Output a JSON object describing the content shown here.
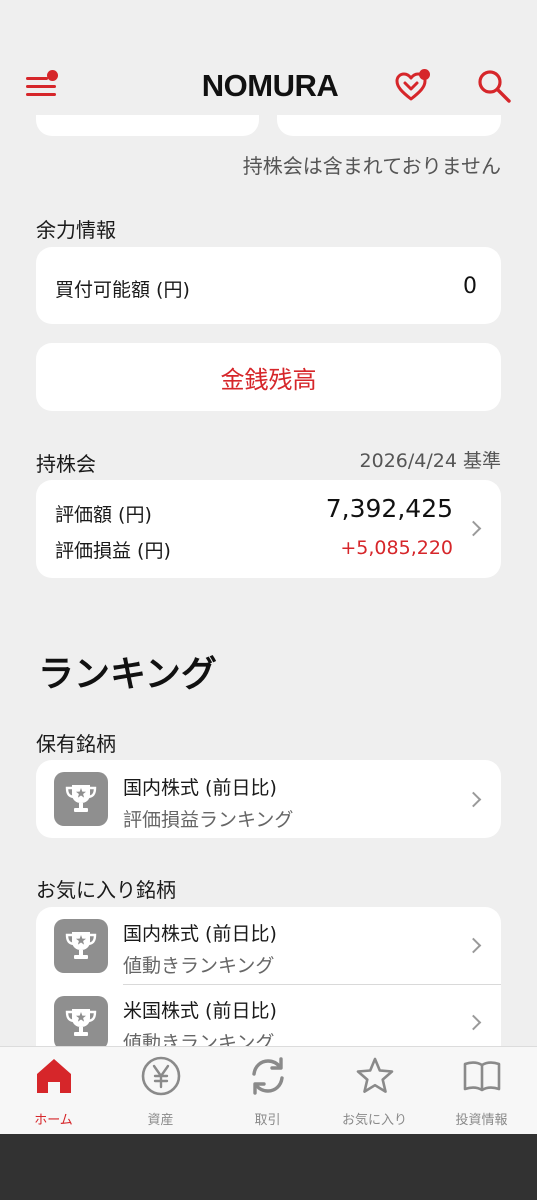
{
  "header": {
    "logo": "NOMURA",
    "menu_icon": "hamburger-menu-icon",
    "favorite_icon": "heart-icon",
    "search_icon": "search-icon",
    "accent_color": "#d6262a"
  },
  "assets_note": "持株会は含まれておりません",
  "buying_power": {
    "section_title": "余力情報",
    "label": "買付可能額 (円)",
    "value": "0",
    "cash_balance_button": "金銭残高"
  },
  "esop": {
    "section_title": "持株会",
    "as_of": "2026/4/24 基準",
    "valuation_label": "評価額 (円)",
    "valuation_value": "7,392,425",
    "pl_label": "評価損益 (円)",
    "pl_value": "+5,085,220",
    "pl_color": "#d6262a"
  },
  "ranking": {
    "heading": "ランキング",
    "holdings": {
      "section_title": "保有銘柄",
      "items": [
        {
          "title": "国内株式 (前日比)",
          "subtitle": "評価損益ランキング",
          "icon": "trophy-icon"
        }
      ]
    },
    "favorites": {
      "section_title": "お気に入り銘柄",
      "items": [
        {
          "title": "国内株式 (前日比)",
          "subtitle": "値動きランキング",
          "icon": "trophy-icon"
        },
        {
          "title": "米国株式 (前日比)",
          "subtitle": "値動きランキング",
          "icon": "trophy-icon"
        }
      ]
    }
  },
  "bottom_nav": [
    {
      "label": "ホーム",
      "icon": "home-icon",
      "active": true
    },
    {
      "label": "資産",
      "icon": "yen-icon",
      "active": false
    },
    {
      "label": "取引",
      "icon": "refresh-icon",
      "active": false
    },
    {
      "label": "お気に入り",
      "icon": "star-icon",
      "active": false
    },
    {
      "label": "投資情報",
      "icon": "book-icon",
      "active": false
    }
  ]
}
